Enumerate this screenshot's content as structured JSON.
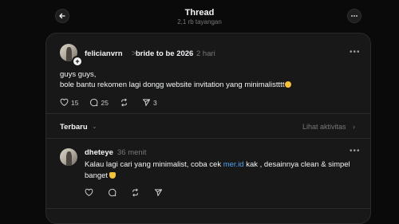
{
  "header": {
    "title": "Thread",
    "views": "2,1 rb tayangan"
  },
  "post": {
    "username": "felicianvrn",
    "separator": ">",
    "community": "bride to be 2026",
    "time": "2 hari",
    "text_line1": "guys guys,",
    "text_line2": "bole bantu rekomen lagi dongg website invitation yang minimalistttt",
    "likes": "15",
    "comments": "25",
    "reposts": "",
    "shares": "3"
  },
  "replies_section": {
    "sort_label": "Terbaru",
    "sort_chevron": "⌄",
    "activity_label": "Lihat aktivitas",
    "activity_chevron": "›"
  },
  "reply": {
    "username": "dheteye",
    "time": "36 menit",
    "text_before_link": "Kalau lagi cari yang minimalist, coba cek ",
    "link": "mer.id",
    "text_after_link": " kak , desainnya clean & simpel",
    "text_line2": "banget"
  },
  "colors": {
    "background": "#0a0a0a",
    "card": "#181818",
    "link": "#4ea3f5",
    "muted": "#777777"
  },
  "icons": {
    "back": "arrow-left-icon",
    "more": "more-horizontal-icon",
    "like": "heart-icon",
    "comment": "comment-icon",
    "repost": "repost-icon",
    "share": "send-icon"
  }
}
